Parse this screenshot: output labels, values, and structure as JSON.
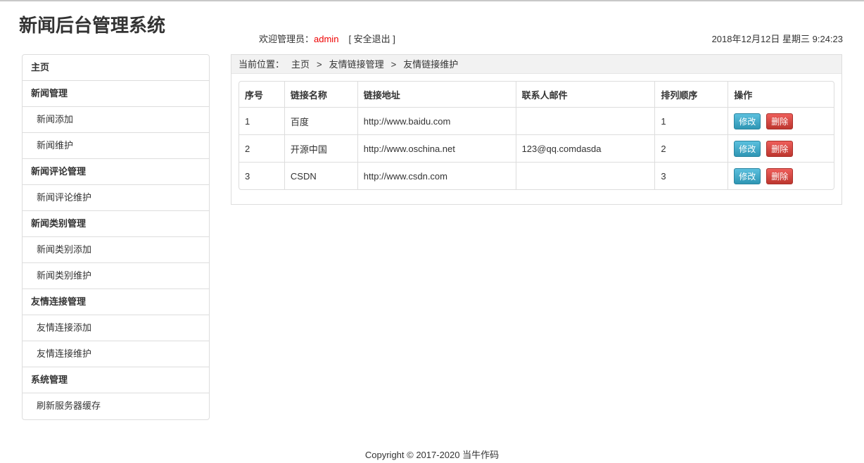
{
  "header": {
    "title": "新闻后台管理系统",
    "welcome_label": "欢迎管理员：",
    "username": "admin",
    "logout": "[ 安全退出 ]",
    "datetime": "2018年12月12日 星期三 9:24:23"
  },
  "sidebar": {
    "items": [
      {
        "label": "主页",
        "type": "group"
      },
      {
        "label": "新闻管理",
        "type": "group"
      },
      {
        "label": "新闻添加",
        "type": "sub"
      },
      {
        "label": "新闻维护",
        "type": "sub"
      },
      {
        "label": "新闻评论管理",
        "type": "group"
      },
      {
        "label": "新闻评论维护",
        "type": "sub"
      },
      {
        "label": "新闻类别管理",
        "type": "group"
      },
      {
        "label": "新闻类别添加",
        "type": "sub"
      },
      {
        "label": "新闻类别维护",
        "type": "sub"
      },
      {
        "label": "友情连接管理",
        "type": "group"
      },
      {
        "label": "友情连接添加",
        "type": "sub"
      },
      {
        "label": "友情连接维护",
        "type": "sub"
      },
      {
        "label": "系统管理",
        "type": "group"
      },
      {
        "label": "刷新服务器缓存",
        "type": "sub"
      }
    ]
  },
  "breadcrumb": {
    "label": "当前位置：",
    "items": [
      "主页",
      "友情链接管理",
      "友情链接维护"
    ],
    "sep": ">"
  },
  "table": {
    "columns": [
      "序号",
      "链接名称",
      "链接地址",
      "联系人邮件",
      "排列顺序",
      "操作"
    ],
    "rows": [
      [
        "1",
        "百度",
        "http://www.baidu.com",
        "",
        "1"
      ],
      [
        "2",
        "开源中国",
        "http://www.oschina.net",
        "123@qq.comdasda",
        "2"
      ],
      [
        "3",
        "CSDN",
        "http://www.csdn.com",
        "",
        "3"
      ]
    ],
    "edit_label": "修改",
    "delete_label": "删除"
  },
  "footer": "Copyright © 2017-2020 当牛作码"
}
